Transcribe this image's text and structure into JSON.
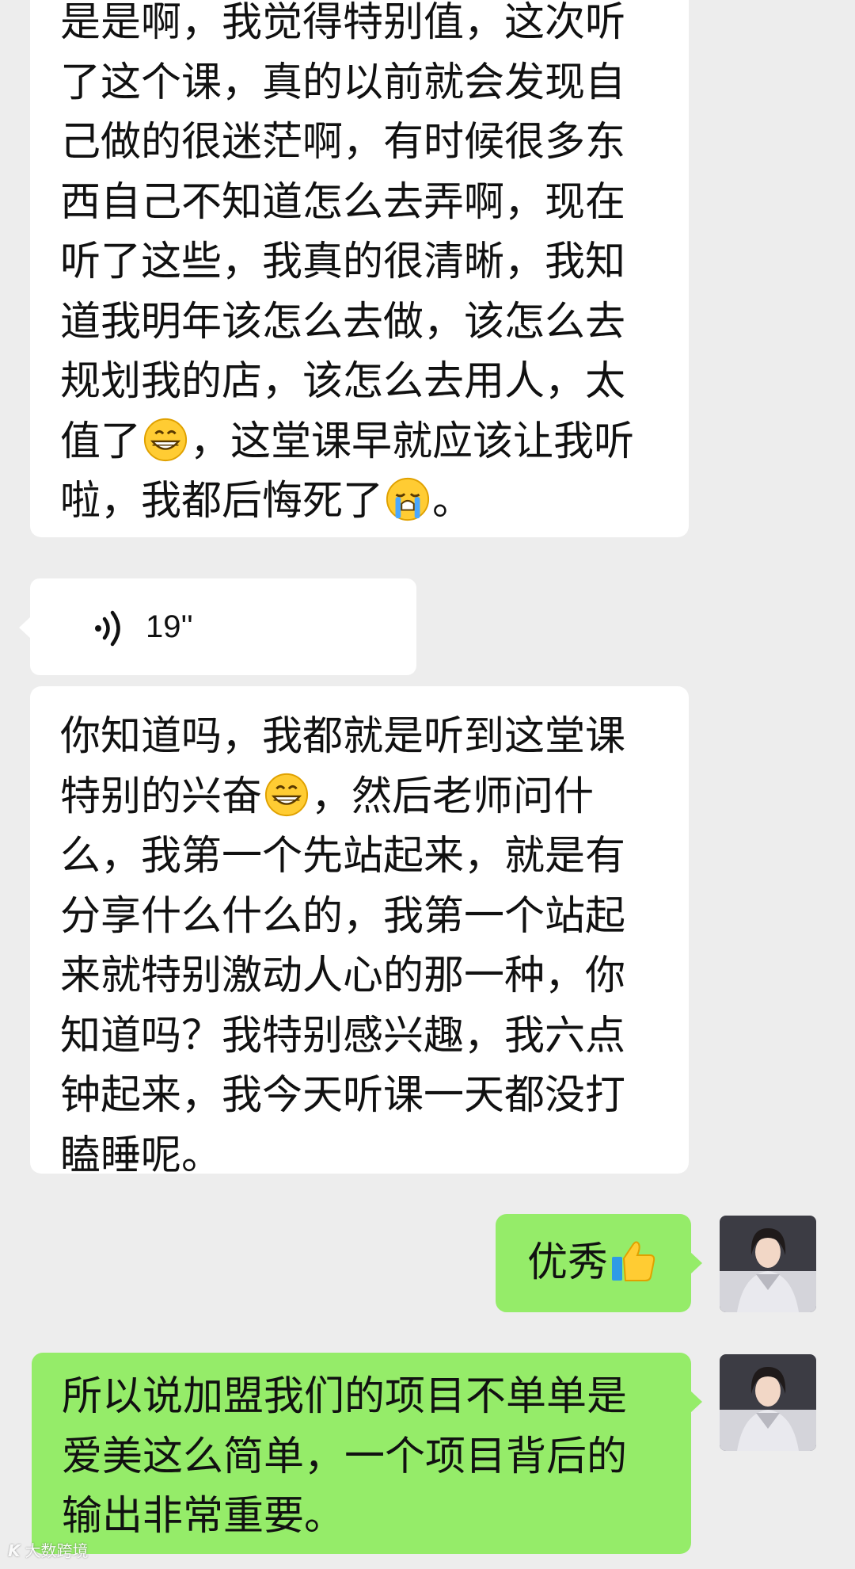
{
  "messages": [
    {
      "side": "left",
      "type": "text",
      "segments": [
        {
          "text": "是是啊，我觉得特别值，这次听了这个课，真的以前就会发现自己做的很迷茫啊，有时候很多东西自己不知道怎么去弄啊，现在听了这些，我真的很清晰，我知道我明年该怎么去做，该怎么去规划我的店，该怎么去用人，太值了"
        },
        {
          "emoji": "grinning-face"
        },
        {
          "text": "，这堂课早就应该让我听啦，我都后悔死了"
        },
        {
          "emoji": "crying-face"
        },
        {
          "text": "。"
        }
      ]
    },
    {
      "side": "left",
      "type": "voice",
      "duration": "19''"
    },
    {
      "side": "left",
      "type": "text",
      "segments": [
        {
          "text": "你知道吗，我都就是听到这堂课特别的兴奋"
        },
        {
          "emoji": "grinning-face"
        },
        {
          "text": "，然后老师问什么，我第一个先站起来，就是有分享什么什么的，我第一个站起来就特别激动人心的那一种，你知道吗？我特别感兴趣，我六点钟起来，我今天听课一天都没打瞌睡呢。"
        }
      ]
    },
    {
      "side": "right",
      "type": "text",
      "segments": [
        {
          "text": "优秀"
        },
        {
          "emoji": "thumbs-up"
        }
      ]
    },
    {
      "side": "right",
      "type": "text",
      "segments": [
        {
          "text": "所以说加盟我们的项目不单单是爱美这么简单，一个项目背后的输出非常重要。"
        }
      ]
    }
  ],
  "watermark": {
    "logo": "K",
    "text": "大数跨境"
  },
  "colors": {
    "background": "#ededed",
    "left_bubble": "#ffffff",
    "right_bubble": "#95ec69"
  }
}
